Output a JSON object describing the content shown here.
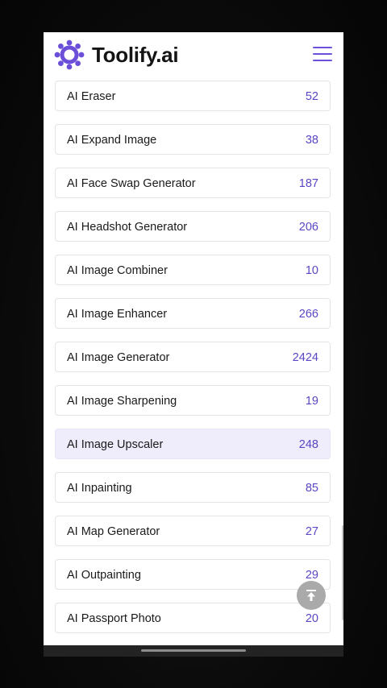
{
  "app": {
    "brand": "Toolify.ai",
    "brand_color": "#6b4fd8"
  },
  "navbar": {
    "logo_icon": "toolify-logo-icon",
    "menu_icon": "hamburger-menu-icon"
  },
  "categories": [
    {
      "label": "AI Eraser",
      "count": "52",
      "active": false
    },
    {
      "label": "AI Expand Image",
      "count": "38",
      "active": false
    },
    {
      "label": "AI Face Swap Generator",
      "count": "187",
      "active": false
    },
    {
      "label": "AI Headshot Generator",
      "count": "206",
      "active": false
    },
    {
      "label": "AI Image Combiner",
      "count": "10",
      "active": false
    },
    {
      "label": "AI Image Enhancer",
      "count": "266",
      "active": false
    },
    {
      "label": "AI Image Generator",
      "count": "2424",
      "active": false
    },
    {
      "label": "AI Image Sharpening",
      "count": "19",
      "active": false
    },
    {
      "label": "AI Image Upscaler",
      "count": "248",
      "active": true
    },
    {
      "label": "AI Inpainting",
      "count": "85",
      "active": false
    },
    {
      "label": "AI Map Generator",
      "count": "27",
      "active": false
    },
    {
      "label": "AI Outpainting",
      "count": "29",
      "active": false
    },
    {
      "label": "AI Passport Photo",
      "count": "20",
      "active": false
    }
  ],
  "scroll_to_top": {
    "icon": "arrow-up-to-top-icon"
  },
  "colors": {
    "count_text": "#5b45c2",
    "active_row": "#efecfb"
  }
}
